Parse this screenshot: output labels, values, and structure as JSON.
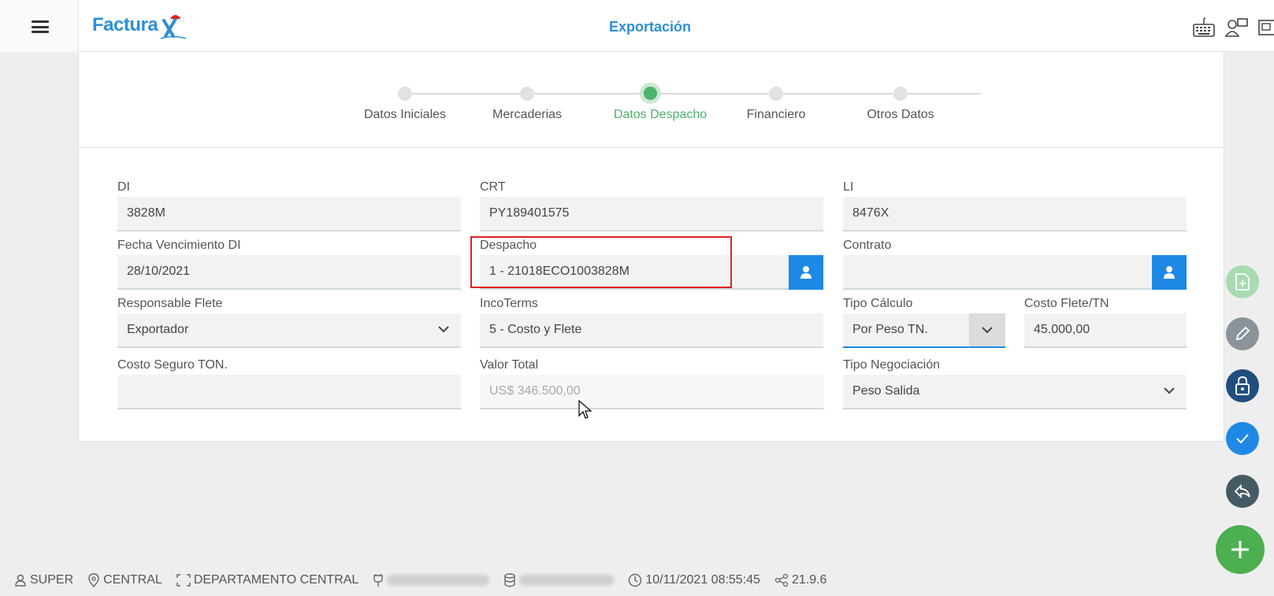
{
  "header": {
    "brand": "Factura",
    "title": "Exportación"
  },
  "stepper": {
    "steps": [
      "Datos Iniciales",
      "Mercaderias",
      "Datos Despacho",
      "Financiero",
      "Otros Datos"
    ],
    "active": "Datos Despacho"
  },
  "form": {
    "di": {
      "label": "DI",
      "value": "3828M"
    },
    "crt": {
      "label": "CRT",
      "value": "PY189401575"
    },
    "li": {
      "label": "LI",
      "value": "8476X"
    },
    "fecha_venc": {
      "label": "Fecha Vencimiento DI",
      "value": "28/10/2021"
    },
    "despacho": {
      "label": "Despacho",
      "value": "1 - 21018ECO1003828M"
    },
    "contrato": {
      "label": "Contrato",
      "value": ""
    },
    "resp_flete": {
      "label": "Responsable Flete",
      "value": "Exportador"
    },
    "incoterms": {
      "label": "IncoTerms",
      "value": "5 - Costo y Flete"
    },
    "tipo_calculo": {
      "label": "Tipo Cálculo",
      "value": "Por Peso TN."
    },
    "costo_flete": {
      "label": "Costo Flete/TN",
      "value": "45.000,00"
    },
    "costo_seguro": {
      "label": "Costo Seguro TON.",
      "value": ""
    },
    "valor_total": {
      "label": "Valor Total",
      "value": "US$ 346.500,00"
    },
    "tipo_negociacion": {
      "label": "Tipo Negociación",
      "value": "Peso Salida"
    }
  },
  "footer": {
    "user": "SUPER",
    "location": "CENTRAL",
    "department": "DEPARTAMENTO CENTRAL",
    "datetime": "10/11/2021 08:55:45",
    "version": "21.9.6"
  },
  "colors": {
    "brand": "#2d8fd5",
    "active_step": "#4cb36a",
    "button_blue": "#1e88e5",
    "fab_green": "#4caf50",
    "highlight_red": "#e0211d"
  }
}
